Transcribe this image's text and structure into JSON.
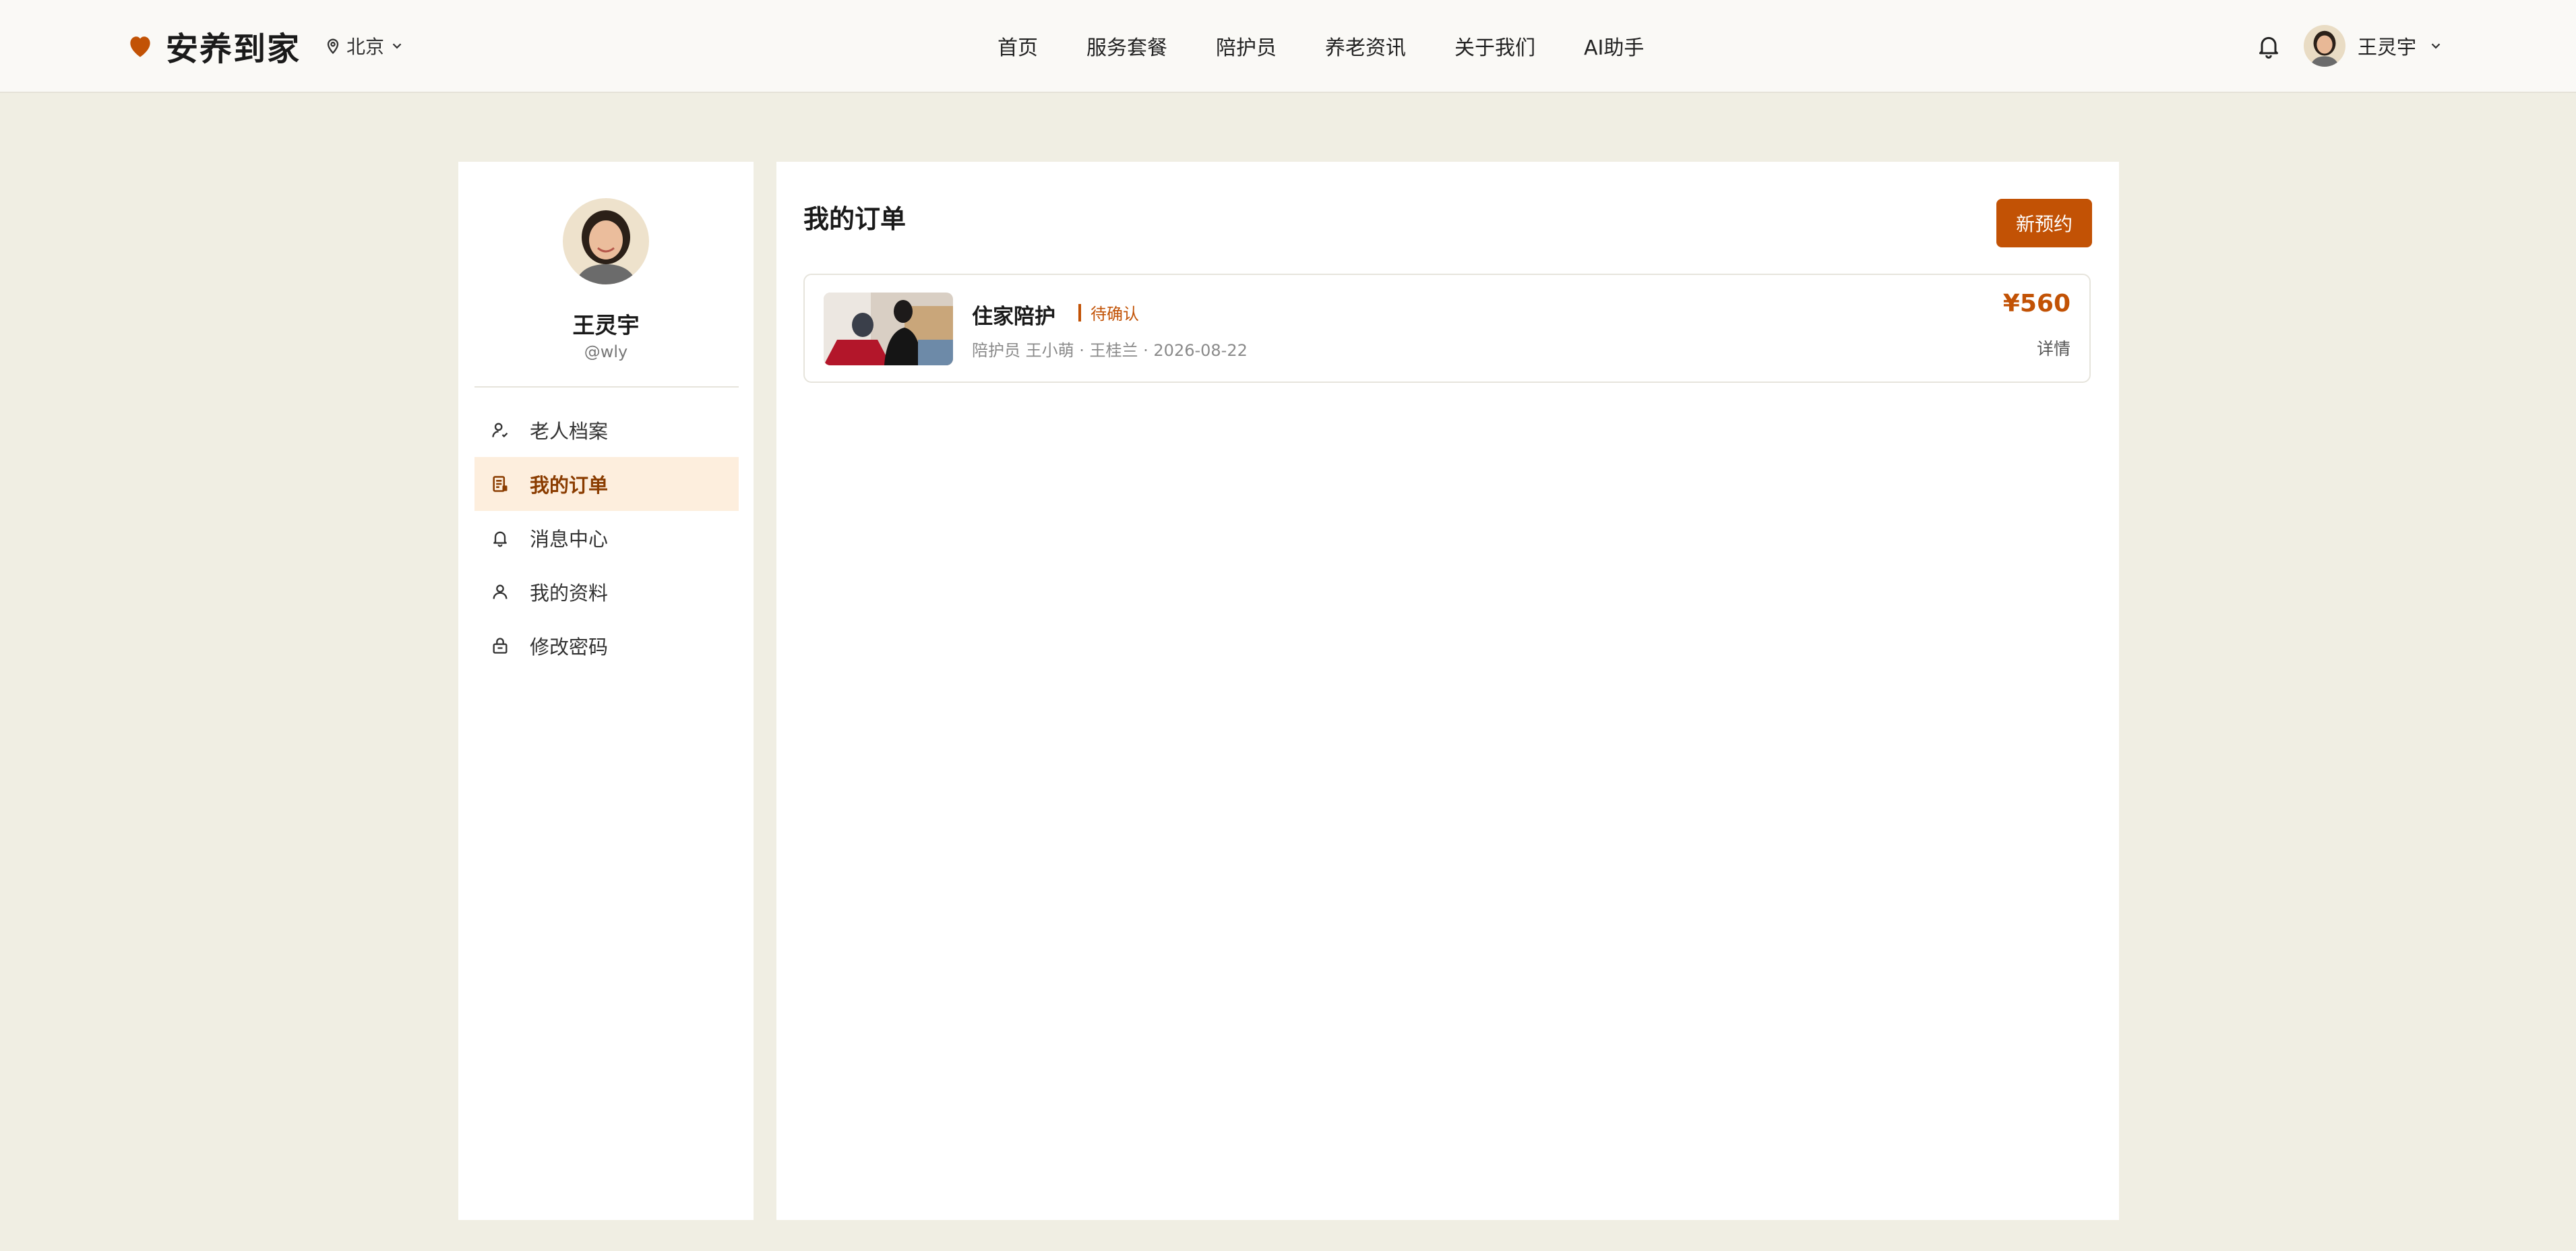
{
  "header": {
    "brand": "安养到家",
    "city": "北京",
    "nav": [
      "首页",
      "服务套餐",
      "陪护员",
      "养老资讯",
      "关于我们",
      "AI助手"
    ],
    "user_name": "王灵宇"
  },
  "sidebar": {
    "name": "王灵宇",
    "handle": "@wly",
    "items": [
      {
        "label": "老人档案",
        "icon": "elder-profile-icon"
      },
      {
        "label": "我的订单",
        "icon": "order-icon",
        "active": true
      },
      {
        "label": "消息中心",
        "icon": "bell-icon"
      },
      {
        "label": "我的资料",
        "icon": "person-icon"
      },
      {
        "label": "修改密码",
        "icon": "lock-icon"
      }
    ]
  },
  "main": {
    "title": "我的订单",
    "new_button": "新预约",
    "orders": [
      {
        "service": "住家陪护",
        "status": "待确认",
        "meta": "陪护员 王小萌 · 王桂兰 · 2026-08-22",
        "price": "¥560",
        "detail": "详情"
      }
    ]
  },
  "colors": {
    "accent": "#c25205",
    "background": "#f0eee3",
    "active_menu_bg": "#fdeedd"
  }
}
